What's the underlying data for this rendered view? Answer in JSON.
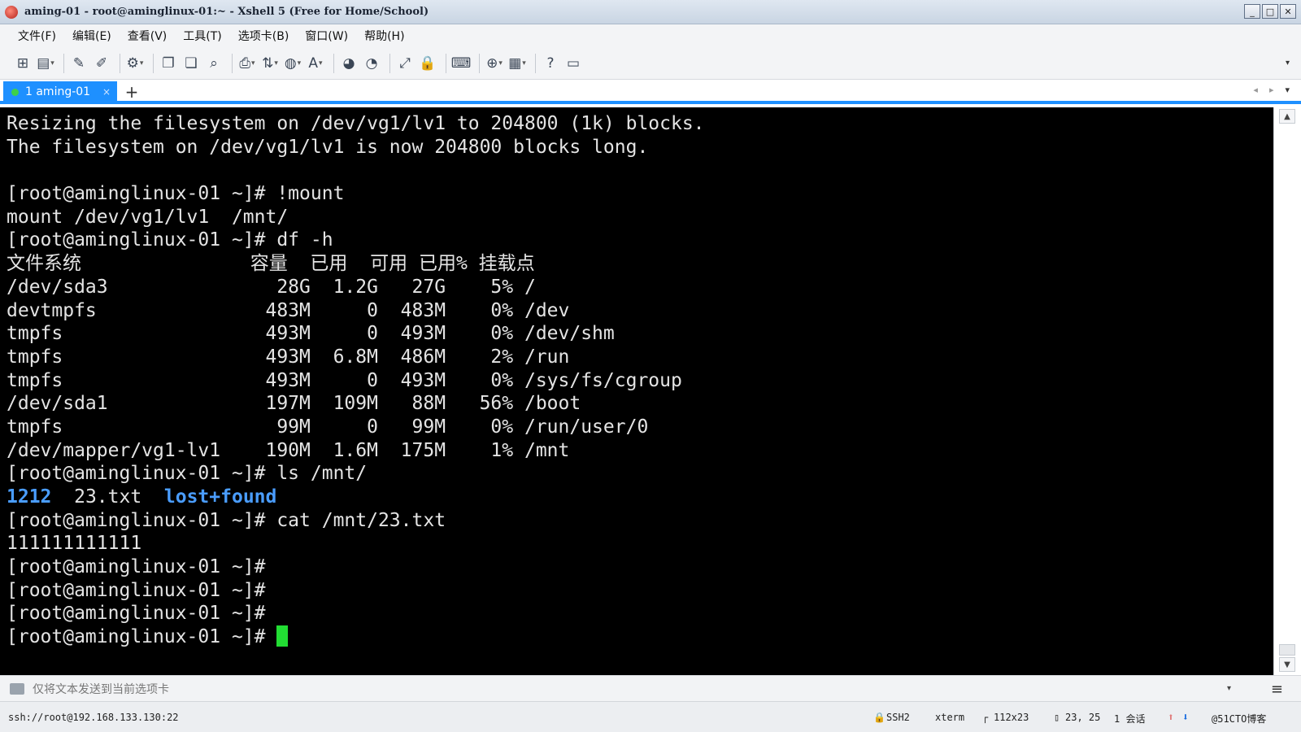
{
  "window": {
    "title": "aming-01 - root@aminglinux-01:~ - Xshell 5 (Free for Home/School)"
  },
  "menu": [
    "文件(F)",
    "编辑(E)",
    "查看(V)",
    "工具(T)",
    "选项卡(B)",
    "窗口(W)",
    "帮助(H)"
  ],
  "tab": {
    "label": "1 aming-01",
    "close": "×",
    "add": "+"
  },
  "terminal": {
    "lines": [
      "Resizing the filesystem on /dev/vg1/lv1 to 204800 (1k) blocks.",
      "The filesystem on /dev/vg1/lv1 is now 204800 blocks long.",
      "",
      "[root@aminglinux-01 ~]# !mount",
      "mount /dev/vg1/lv1  /mnt/",
      "[root@aminglinux-01 ~]# df -h",
      "文件系统               容量  已用  可用 已用% 挂载点",
      "/dev/sda3               28G  1.2G   27G    5% /",
      "devtmpfs               483M     0  483M    0% /dev",
      "tmpfs                  493M     0  493M    0% /dev/shm",
      "tmpfs                  493M  6.8M  486M    2% /run",
      "tmpfs                  493M     0  493M    0% /sys/fs/cgroup",
      "/dev/sda1              197M  109M   88M   56% /boot",
      "tmpfs                   99M     0   99M    0% /run/user/0",
      "/dev/mapper/vg1-lv1    190M  1.6M  175M    1% /mnt",
      "",
      "[root@aminglinux-01 ~]# cat /mnt/23.txt",
      "111111111111",
      "[root@aminglinux-01 ~]#",
      "[root@aminglinux-01 ~]#",
      "[root@aminglinux-01 ~]#",
      "[root@aminglinux-01 ~]# "
    ],
    "ls_prompt": "[root@aminglinux-01 ~]# ls /mnt/",
    "ls_item1": "1212",
    "ls_item2": "23.txt",
    "ls_item3": "lost+found"
  },
  "sendbar": {
    "text": "仅将文本发送到当前选项卡"
  },
  "status": {
    "connection": "ssh://root@192.168.133.130:22",
    "protocol": "SSH2",
    "term": "xterm",
    "size": "112x23",
    "cursor": "23, 25",
    "sessions": "1 会话",
    "watermark": "@51CTO博客"
  },
  "colors": {
    "accent": "#1e90ff",
    "terminal_bg": "#000000",
    "terminal_fg": "#e4e4e4",
    "dir_blue": "#4a9dff",
    "cursor_green": "#22dd33"
  }
}
